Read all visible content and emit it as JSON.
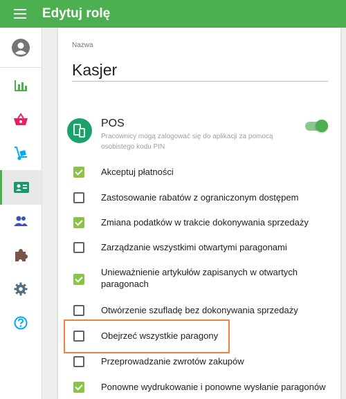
{
  "app": {
    "title": "Edytuj rolę"
  },
  "sidebar": {
    "items": [
      {
        "icon": "bar-chart-icon",
        "color": "#4caf50"
      },
      {
        "icon": "basket-icon",
        "color": "#e91e63"
      },
      {
        "icon": "hand-truck-icon",
        "color": "#03a9f4"
      },
      {
        "icon": "employee-card-icon",
        "color": "#1a9a6a",
        "active": true
      },
      {
        "icon": "people-icon",
        "color": "#3f51b5"
      },
      {
        "icon": "puzzle-icon",
        "color": "#795548"
      },
      {
        "icon": "gear-icon",
        "color": "#546e7a"
      },
      {
        "icon": "help-icon",
        "color": "#03a9f4"
      }
    ]
  },
  "form": {
    "name_label": "Nazwa",
    "name_value": "Kasjer"
  },
  "pos": {
    "title": "POS",
    "description": "Pracownicy mogą zalogować się do aplikacji za pomocą osobistego kodu PIN",
    "enabled": true
  },
  "permissions": [
    {
      "label": "Akceptuj płatności",
      "checked": true
    },
    {
      "label": "Zastosowanie rabatów z ograniczonym dostępem",
      "checked": false
    },
    {
      "label": "Zmiana podatków w trakcie dokonywania sprzedaży",
      "checked": true
    },
    {
      "label": "Zarządzanie wszystkimi otwartymi paragonami",
      "checked": false
    },
    {
      "label": "Unieważnienie artykułów zapisanych w otwartych paragonach",
      "checked": true
    },
    {
      "label": "Otwórzenie szufladę bez dokonywania sprzedaży",
      "checked": false
    },
    {
      "label": "Obejrzeć wszystkie paragony",
      "checked": false
    },
    {
      "label": "Przeprowadzanie zwrotów zakupów",
      "checked": false
    },
    {
      "label": "Ponowne wydrukowanie i ponowne wysłanie paragonów",
      "checked": true
    }
  ],
  "colors": {
    "appbar": "#4caf50",
    "highlight": "#f0803c",
    "checkbox_checked": "#8bc34a"
  }
}
